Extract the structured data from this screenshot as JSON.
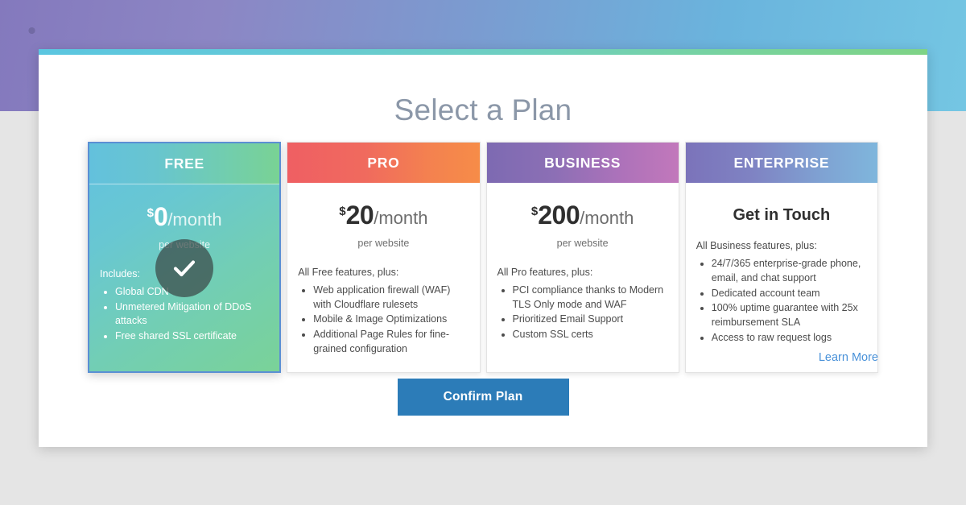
{
  "background": {
    "band_gradient_from": "#8479bd",
    "band_gradient_to": "#74c6e3",
    "page_color": "#e5e5e5"
  },
  "modal": {
    "title": "Select a Plan",
    "top_bar_from": "#5bc6e0",
    "top_bar_to": "#7ed386"
  },
  "plans": [
    {
      "id": "free",
      "name": "FREE",
      "selected": true,
      "currency": "$",
      "amount": "0",
      "period": "/month",
      "per": "per website",
      "features_intro": "Includes:",
      "features": [
        "Global CDN",
        "Unmetered Mitigation of DDoS attacks",
        "Free shared SSL certificate"
      ],
      "header_from": "#63c1dd",
      "header_to": "#79d294",
      "check_icon": "check-icon"
    },
    {
      "id": "pro",
      "name": "PRO",
      "selected": false,
      "currency": "$",
      "amount": "20",
      "period": "/month",
      "per": "per website",
      "features_intro": "All Free features, plus:",
      "features": [
        "Web application firewall (WAF) with Cloudflare rulesets",
        "Mobile & Image Optimizations",
        "Additional Page Rules for fine-grained configuration"
      ],
      "header_from": "#ef5f63",
      "header_to": "#f68c48"
    },
    {
      "id": "business",
      "name": "BUSINESS",
      "selected": false,
      "currency": "$",
      "amount": "200",
      "period": "/month",
      "per": "per website",
      "features_intro": "All Pro features, plus:",
      "features": [
        "PCI compliance thanks to Modern TLS Only mode and WAF",
        "Prioritized Email Support",
        "Custom SSL certs"
      ],
      "header_from": "#7d6ab2",
      "header_to": "#c278bb"
    },
    {
      "id": "enterprise",
      "name": "ENTERPRISE",
      "selected": false,
      "headline": "Get in Touch",
      "features_intro": "All Business features, plus:",
      "features": [
        "24/7/365 enterprise-grade phone, email, and chat support",
        "Dedicated account team",
        "100% uptime guarantee with 25x reimbursement SLA",
        "Access to raw request logs"
      ],
      "header_from": "#7b73ba",
      "header_to": "#7fb6dc"
    }
  ],
  "footer": {
    "learn_more_label": "Learn More",
    "confirm_label": "Confirm Plan",
    "confirm_color": "#2c7cb8",
    "link_color": "#4a92d9"
  }
}
